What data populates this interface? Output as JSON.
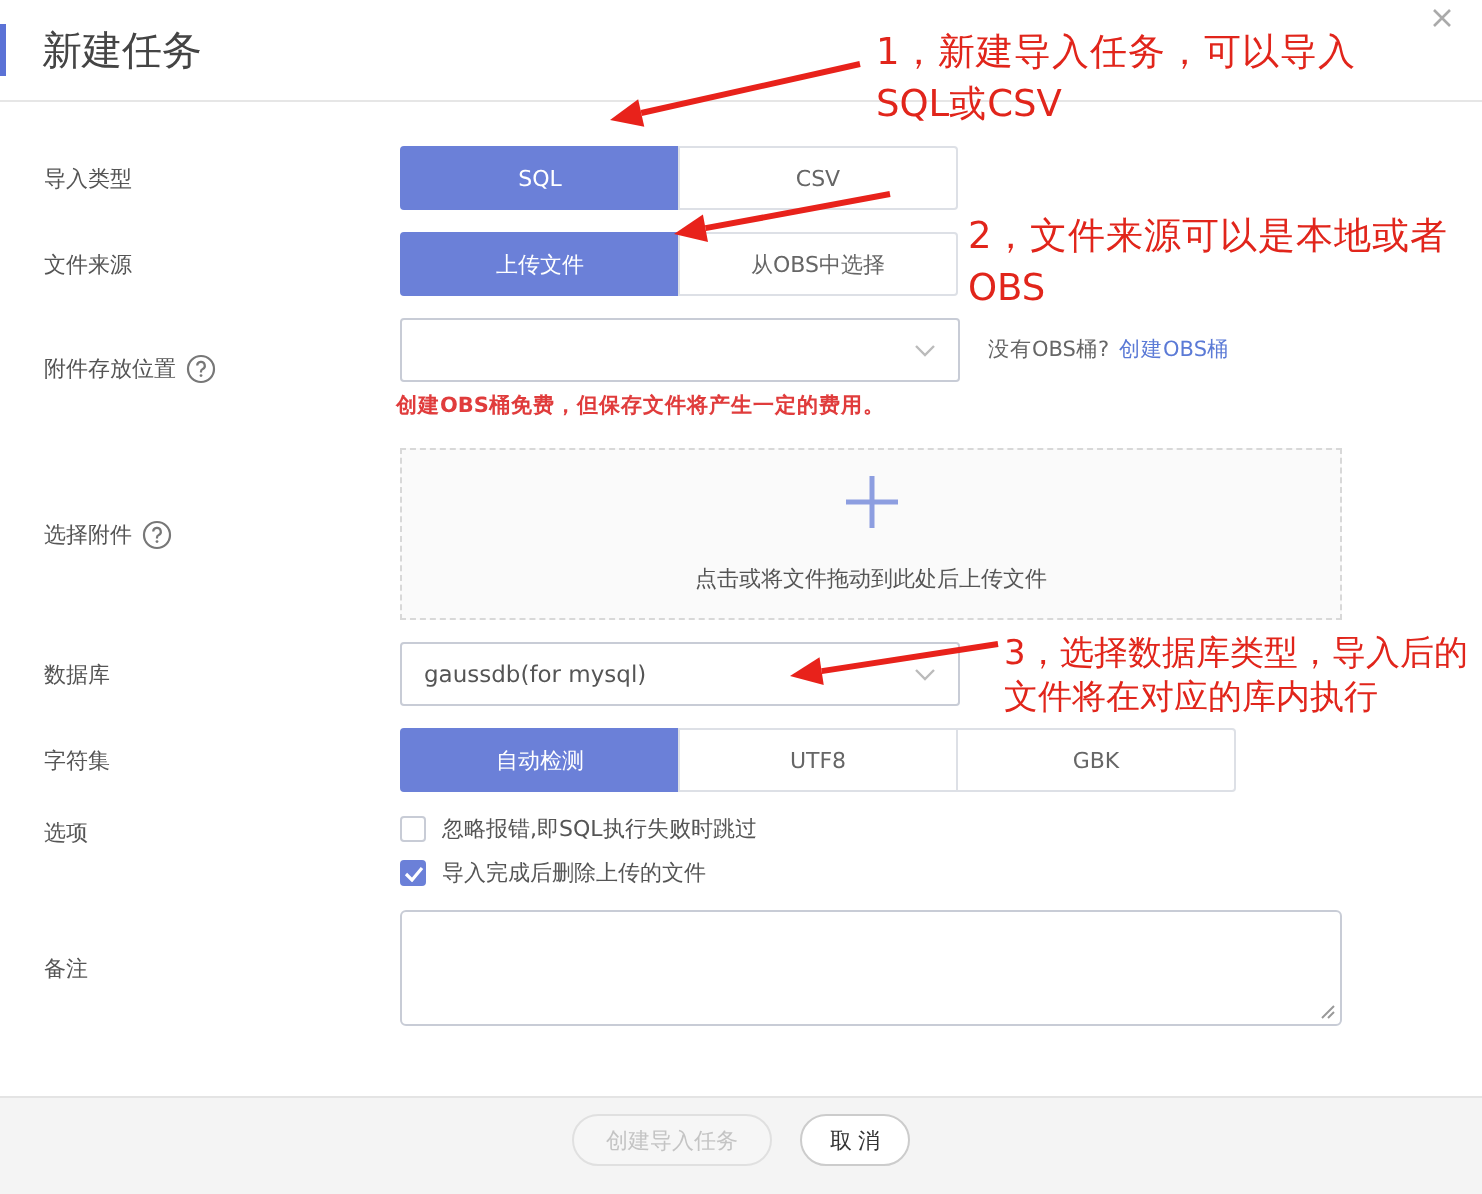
{
  "dialog": {
    "title": "新建任务"
  },
  "rows": [
    {
      "kind": "segmented",
      "label": "导入类型",
      "options": [
        {
          "label": "SQL",
          "selected": true
        },
        {
          "label": "CSV",
          "selected": false
        }
      ]
    },
    {
      "kind": "segmented",
      "label": "文件来源",
      "options": [
        {
          "label": "上传文件",
          "selected": true
        },
        {
          "label": "从OBS中选择",
          "selected": false
        }
      ]
    },
    {
      "kind": "select",
      "label": "附件存放位置",
      "help": true,
      "aside": "没有OBS桶?",
      "link": "创建OBS桶",
      "error": "创建OBS桶免费，但保存文件将产生一定的费用。"
    },
    {
      "kind": "dropzone",
      "label": "选择附件",
      "help": true,
      "hint": "点击或将文件拖动到此处后上传文件"
    },
    {
      "kind": "select",
      "label": "数据库",
      "value": "gaussdb(for mysql)"
    },
    {
      "kind": "segmented",
      "label": "字符集",
      "options": [
        {
          "label": "自动检测",
          "selected": true
        },
        {
          "label": "UTF8",
          "selected": false
        },
        {
          "label": "GBK",
          "selected": false
        }
      ]
    },
    {
      "kind": "checkboxes",
      "label": "选项",
      "items": [
        {
          "label": "忽略报错,即SQL执行失败时跳过",
          "checked": false
        },
        {
          "label": "导入完成后删除上传的文件",
          "checked": true
        }
      ]
    },
    {
      "kind": "textarea",
      "label": "备注"
    }
  ],
  "buttons": [
    {
      "label": "创建导入任务",
      "disabled": true
    },
    {
      "label": "取 消",
      "disabled": false
    }
  ],
  "annotations": [
    {
      "text": "1，新建导入任务，可以导入SQL或CSV"
    },
    {
      "text": "2，文件来源可以是本地或者OBS"
    },
    {
      "text": "3，选择数据库类型，导入后的文件将在对应的库内执行"
    }
  ]
}
